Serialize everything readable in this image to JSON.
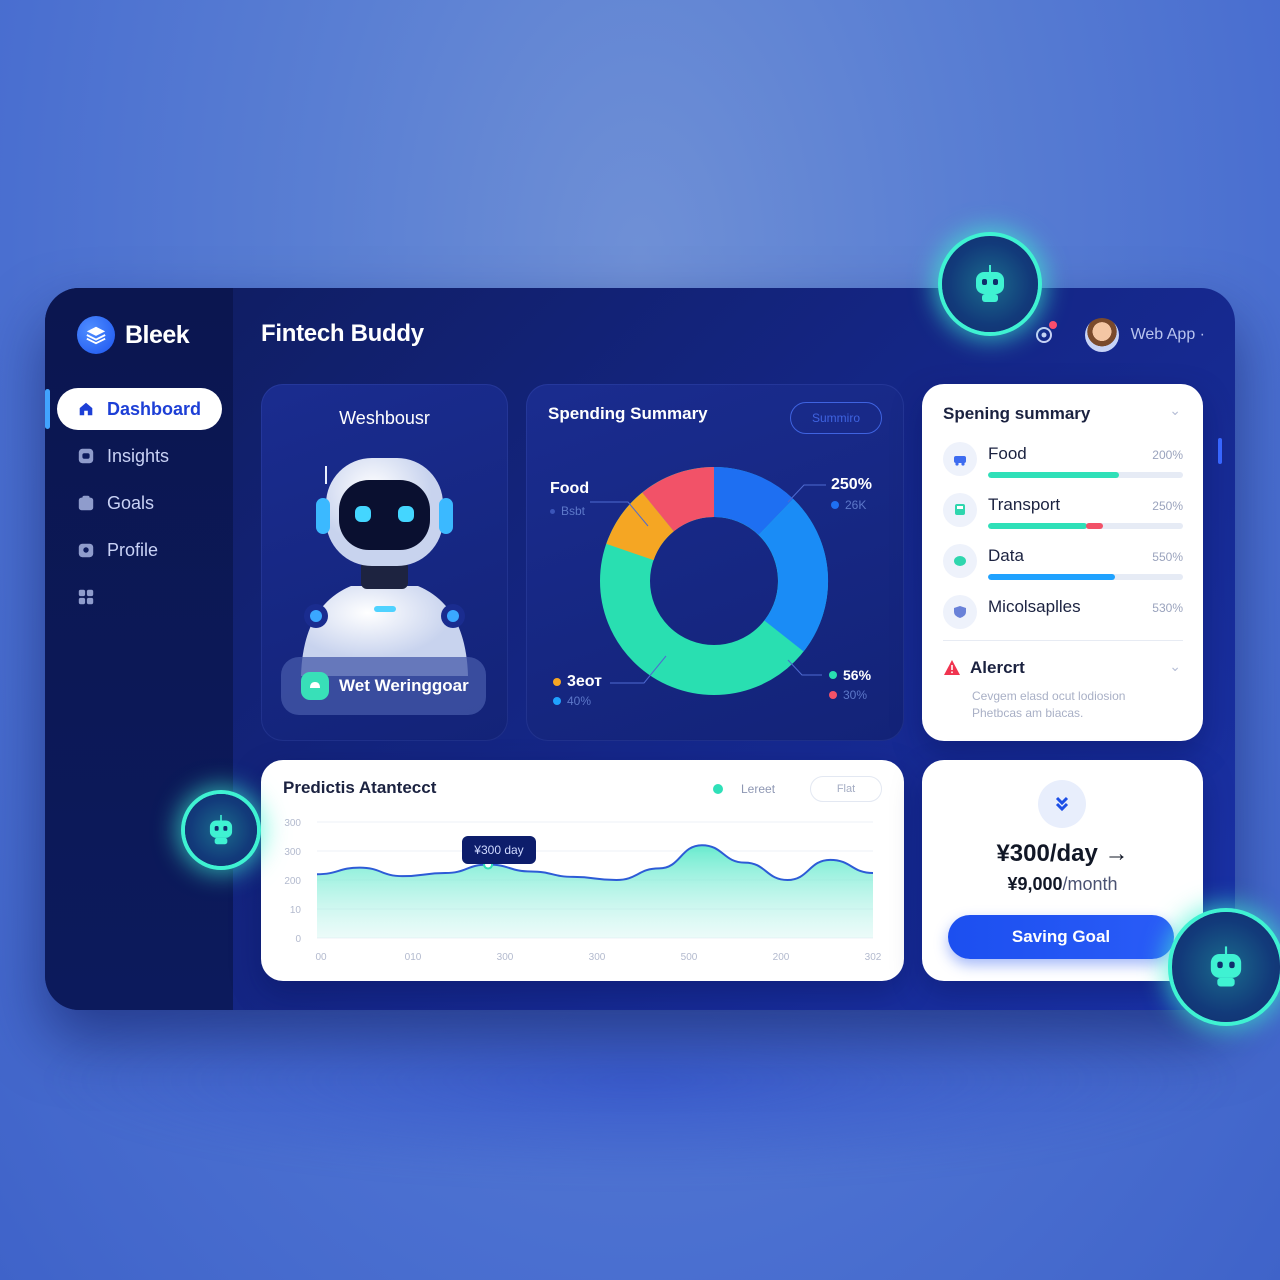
{
  "brand": {
    "name": "Bleek"
  },
  "header": {
    "title": "Fintech Buddy",
    "app_label": "Web App ·"
  },
  "sidebar": {
    "items": [
      {
        "label": "Dashboard",
        "icon": "home-icon",
        "active": true
      },
      {
        "label": "Insights",
        "icon": "insights-icon"
      },
      {
        "label": "Goals",
        "icon": "goals-icon"
      },
      {
        "label": "Profile",
        "icon": "profile-icon"
      },
      {
        "label": "",
        "icon": "grid-icon"
      }
    ]
  },
  "assistant": {
    "title": "Weshbousr",
    "button_label": "Wet Weringgoar"
  },
  "spending_donut": {
    "title": "Spending Summary",
    "pill_label": "Summiro",
    "label_top_left": "Food",
    "label_top_left_sub": "Bsbt",
    "label_top_right": "250%",
    "label_top_right_sub": "26K",
    "label_bottom_left": "3еот",
    "label_bottom_left_sub": "40%",
    "label_bottom_right": "56%",
    "label_bottom_right_sub": "30%",
    "colors": {
      "red": "#f25268",
      "blue": "#1e6ff2",
      "teal": "#29dfb1",
      "orange": "#f5a623"
    }
  },
  "summary": {
    "title": "Spening summary",
    "rows": [
      {
        "name": "Food",
        "pct": "200%",
        "icon": "car-icon",
        "fill": 0.7,
        "color": "#2fe0b8"
      },
      {
        "name": "Transport",
        "pct": "250%",
        "icon": "bus-icon",
        "fill": 0.6,
        "color": "#2fe0b8",
        "accent": "#f25268"
      },
      {
        "name": "Data",
        "pct": "550%",
        "icon": "data-icon",
        "fill": 0.65,
        "color": "#1fa2ff"
      },
      {
        "name": "Micolsaplles",
        "pct": "530%",
        "icon": "shield-icon"
      }
    ],
    "alert_title": "Alercrt",
    "alert_body": "Cevgem elasd ocut lodiosion Phetbcas am biacas."
  },
  "predict": {
    "title": "Predictis Atantecct",
    "legend_label": "Lereet",
    "pill_label": "Flat",
    "tooltip": "¥300 day",
    "y_ticks": [
      "300",
      "300",
      "200",
      "10",
      "0"
    ],
    "x_ticks": [
      "00",
      "010",
      "300",
      "300",
      "500",
      "200",
      "302"
    ]
  },
  "saving": {
    "main": "¥300/day →",
    "sub_amount": "¥9,000",
    "sub_unit": "/month",
    "button_label": "Saving Goal"
  },
  "chart_data": {
    "type": "area",
    "title": "Predictis Atantecct",
    "ylim": [
      0,
      300
    ],
    "y_ticks": [
      "300",
      "300",
      "200",
      "10",
      "0"
    ],
    "x_ticks": [
      "00",
      "010",
      "300",
      "300",
      "500",
      "200",
      "302"
    ],
    "series": [
      {
        "name": "Lereet",
        "values": [
          165,
          182,
          160,
          168,
          190,
          172,
          158,
          150,
          180,
          240,
          195,
          150,
          202,
          168
        ]
      }
    ],
    "highlight": {
      "index": 4,
      "label": "¥300 day"
    }
  }
}
